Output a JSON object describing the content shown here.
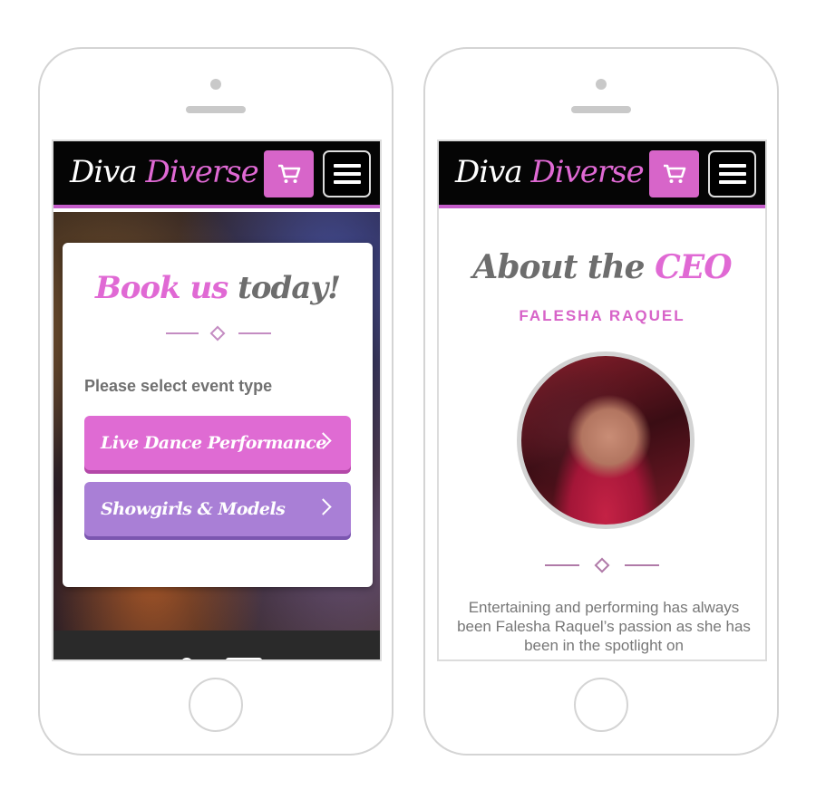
{
  "brand": {
    "word1": "Diva",
    "word2": "Diverse"
  },
  "colors": {
    "accent_pink": "#df6bd3",
    "accent_purple": "#a97fd6",
    "topbar": "#050505",
    "heading_grey": "#6d6d6d"
  },
  "icons": {
    "cart": "cart-icon",
    "menu": "hamburger-menu-icon",
    "chevron": "chevron-right-icon"
  },
  "booking": {
    "title_accent": "Book us",
    "title_rest": "today!",
    "prompt": "Please select event type",
    "options": [
      {
        "label": "Live Dance Performance"
      },
      {
        "label": "Showgirls & Models"
      }
    ]
  },
  "about": {
    "title_rest": "About the",
    "title_accent": "CEO",
    "name": "FALESHA RAQUEL",
    "bio": "Entertaining and performing has always been Falesha Raquel’s passion as she has been in the spotlight on"
  }
}
